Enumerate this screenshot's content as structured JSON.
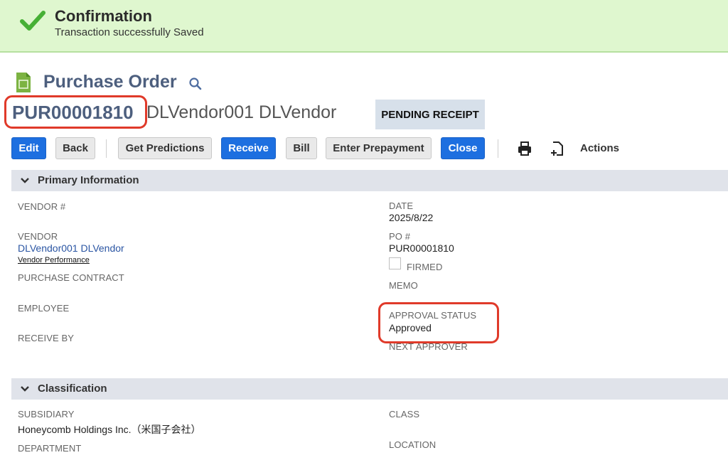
{
  "confirmation": {
    "title": "Confirmation",
    "message": "Transaction successfully Saved"
  },
  "header": {
    "page_title": "Purchase Order",
    "record_id": "PUR00001810",
    "record_name": "DLVendor001 DLVendor",
    "status": "PENDING RECEIPT"
  },
  "toolbar": {
    "edit": "Edit",
    "back": "Back",
    "get_predictions": "Get Predictions",
    "receive": "Receive",
    "bill": "Bill",
    "enter_prepayment": "Enter Prepayment",
    "close": "Close",
    "actions": "Actions"
  },
  "primary": {
    "section_title": "Primary Information",
    "vendor_no_label": "VENDOR #",
    "vendor_label": "VENDOR",
    "vendor_value": "DLVendor001 DLVendor",
    "vendor_performance": "Vendor Performance",
    "purchase_contract_label": "PURCHASE CONTRACT",
    "employee_label": "EMPLOYEE",
    "receive_by_label": "RECEIVE BY",
    "date_label": "DATE",
    "date_value": "2025/8/22",
    "po_label": "PO #",
    "po_value": "PUR00001810",
    "firmed_label": "FIRMED",
    "memo_label": "MEMO",
    "approval_status_label": "APPROVAL STATUS",
    "approval_status_value": "Approved",
    "next_approver_label": "NEXT APPROVER"
  },
  "classification": {
    "section_title": "Classification",
    "subsidiary_label": "SUBSIDIARY",
    "subsidiary_value": "Honeycomb Holdings Inc.（米国子会社）",
    "department_label": "DEPARTMENT",
    "class_label": "CLASS",
    "location_label": "LOCATION"
  },
  "colors": {
    "primary_button": "#1d6fe0",
    "highlight": "#e03a2a",
    "banner": "#dff7cf"
  }
}
